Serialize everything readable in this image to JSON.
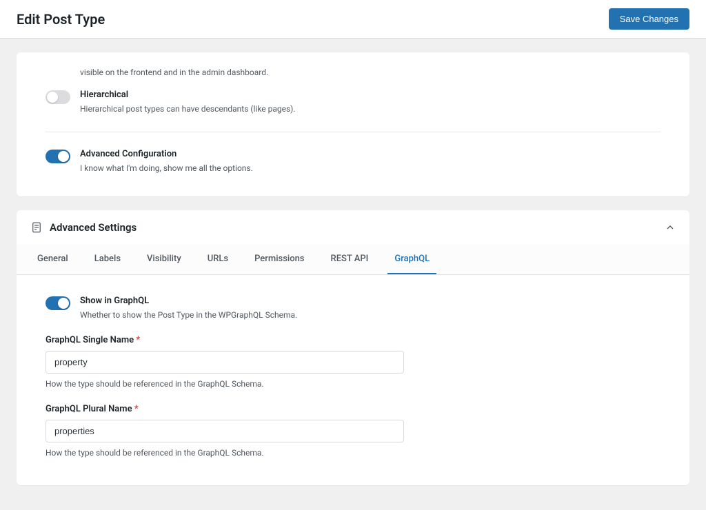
{
  "header": {
    "title": "Edit Post Type",
    "save_button": "Save Changes"
  },
  "top_card": {
    "field_partial_desc": "visible on the frontend and in the admin dashboard.",
    "hierarchical": {
      "label": "Hierarchical",
      "desc": "Hierarchical post types can have descendants (like pages).",
      "on": false
    },
    "advanced_config": {
      "label": "Advanced Configuration",
      "desc": "I know what I'm doing, show me all the options.",
      "on": true
    }
  },
  "advanced": {
    "title": "Advanced Settings",
    "tabs": [
      {
        "label": "General"
      },
      {
        "label": "Labels"
      },
      {
        "label": "Visibility"
      },
      {
        "label": "URLs"
      },
      {
        "label": "Permissions"
      },
      {
        "label": "REST API"
      },
      {
        "label": "GraphQL",
        "active": true
      }
    ],
    "graphql": {
      "show_in_graphql": {
        "label": "Show in GraphQL",
        "desc": "Whether to show the Post Type in the WPGraphQL Schema.",
        "on": true
      },
      "single_name": {
        "label": "GraphQL Single Name",
        "value": "property",
        "help": "How the type should be referenced in the GraphQL Schema."
      },
      "plural_name": {
        "label": "GraphQL Plural Name",
        "value": "properties",
        "help": "How the type should be referenced in the GraphQL Schema."
      }
    }
  }
}
